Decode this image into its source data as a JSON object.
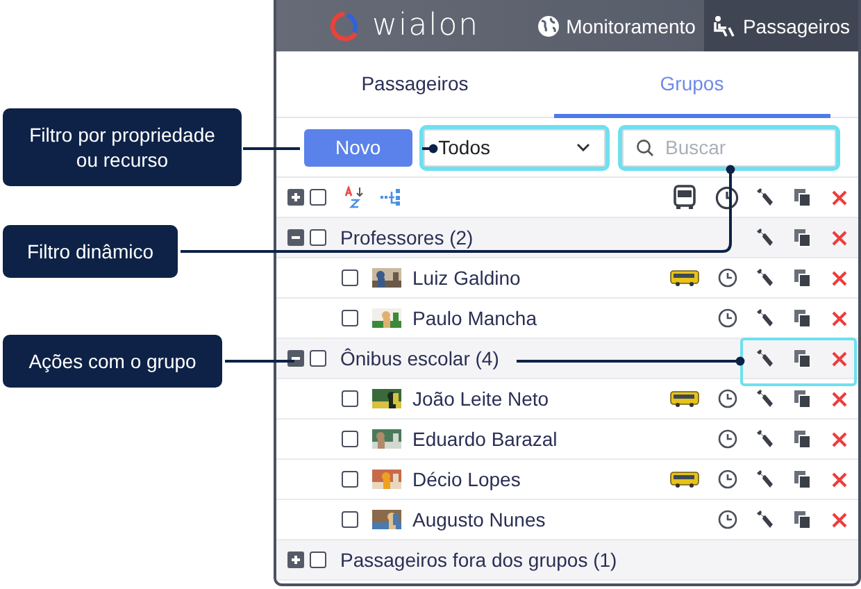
{
  "header": {
    "logo": "wialon",
    "nav": [
      {
        "label": "Monitoramento",
        "selected": false
      },
      {
        "label": "Passageiros",
        "selected": true
      }
    ]
  },
  "tabs": [
    {
      "label": "Passageiros",
      "selected": false
    },
    {
      "label": "Grupos",
      "selected": true
    }
  ],
  "toolbar": {
    "new_button": "Novo",
    "filter": {
      "value": "Todos"
    },
    "search": {
      "placeholder": "Buscar"
    }
  },
  "list_header": {
    "checked": false
  },
  "groups": [
    {
      "name": "Professores (2)",
      "expanded": true,
      "checked": false,
      "members": [
        {
          "name": "Luiz Galdino",
          "checked": false,
          "vehicle": true
        },
        {
          "name": "Paulo Mancha",
          "checked": false,
          "vehicle": false
        }
      ]
    },
    {
      "name": "Ônibus escolar (4)",
      "expanded": true,
      "checked": false,
      "members": [
        {
          "name": "João Leite Neto",
          "checked": false,
          "vehicle": true
        },
        {
          "name": "Eduardo Barazal",
          "checked": false,
          "vehicle": false
        },
        {
          "name": "Décio Lopes",
          "checked": false,
          "vehicle": true
        },
        {
          "name": "Augusto Nunes",
          "checked": false,
          "vehicle": false
        }
      ]
    },
    {
      "name": "Passageiros fora dos grupos (1)",
      "expanded": false,
      "checked": false
    }
  ],
  "callouts": [
    {
      "text": "Filtro por propriedade ou recurso"
    },
    {
      "text": "Filtro dinâmico"
    },
    {
      "text": "Ações com o grupo"
    }
  ]
}
